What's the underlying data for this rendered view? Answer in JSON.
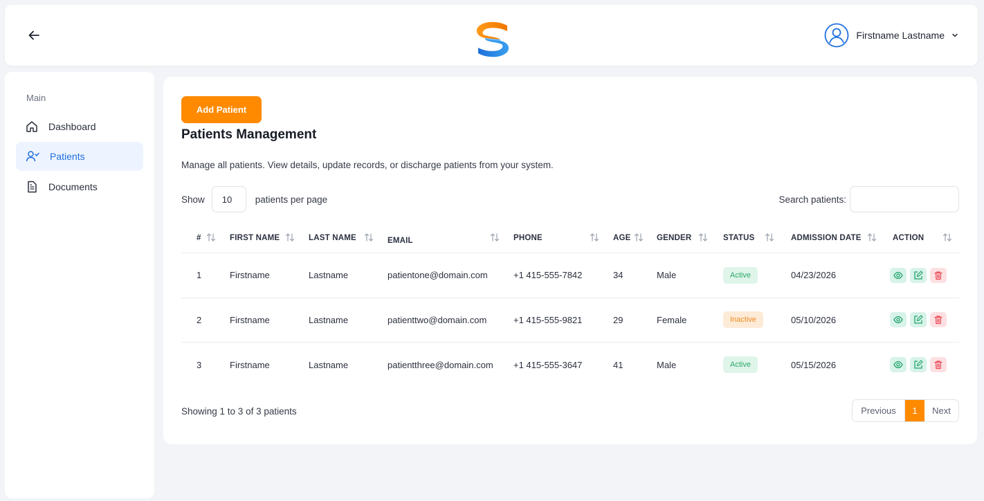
{
  "header": {
    "user_name": "Firstname Lastname"
  },
  "sidebar": {
    "section": "Main",
    "items": [
      {
        "label": "Dashboard",
        "icon": "home-icon",
        "active": false
      },
      {
        "label": "Patients",
        "icon": "users-icon",
        "active": true
      },
      {
        "label": "Documents",
        "icon": "document-icon",
        "active": false
      }
    ]
  },
  "main": {
    "add_button": "Add Patient",
    "title": "Patients Management",
    "subtitle": "Manage all patients. View details, update records, or discharge patients from your system.",
    "show_label": "Show",
    "per_page": "10",
    "per_page_suffix": "patients per page",
    "search_label": "Search patients:",
    "search_value": ""
  },
  "table": {
    "columns": [
      "#",
      "FIRST NAME",
      "LAST NAME",
      "EMAIL",
      "PHONE",
      "AGE",
      "GENDER",
      "STATUS",
      "ADMISSION DATE",
      "ACTION"
    ],
    "rows": [
      {
        "num": "1",
        "first": "Firstname",
        "last": "Lastname",
        "email": "patientone@domain.com",
        "phone": "+1 415-555-7842",
        "age": "34",
        "gender": "Male",
        "status": "Active",
        "date": "04/23/2026"
      },
      {
        "num": "2",
        "first": "Firstname",
        "last": "Lastname",
        "email": "patienttwo@domain.com",
        "phone": "+1 415-555-9821",
        "age": "29",
        "gender": "Female",
        "status": "Inactive",
        "date": "05/10/2026"
      },
      {
        "num": "3",
        "first": "Firstname",
        "last": "Lastname",
        "email": "patientthree@domain.com",
        "phone": "+1 415-555-3647",
        "age": "41",
        "gender": "Male",
        "status": "Active",
        "date": "05/15/2026"
      }
    ]
  },
  "footer": {
    "showing": "Showing 1 to 3 of 3 patients",
    "previous": "Previous",
    "current_page": "1",
    "next": "Next"
  },
  "colors": {
    "accent": "#ff8a00",
    "primary": "#1f6fe0",
    "active_badge": "#2aa86a",
    "inactive_badge": "#f08a1c",
    "delete": "#e8434f"
  }
}
